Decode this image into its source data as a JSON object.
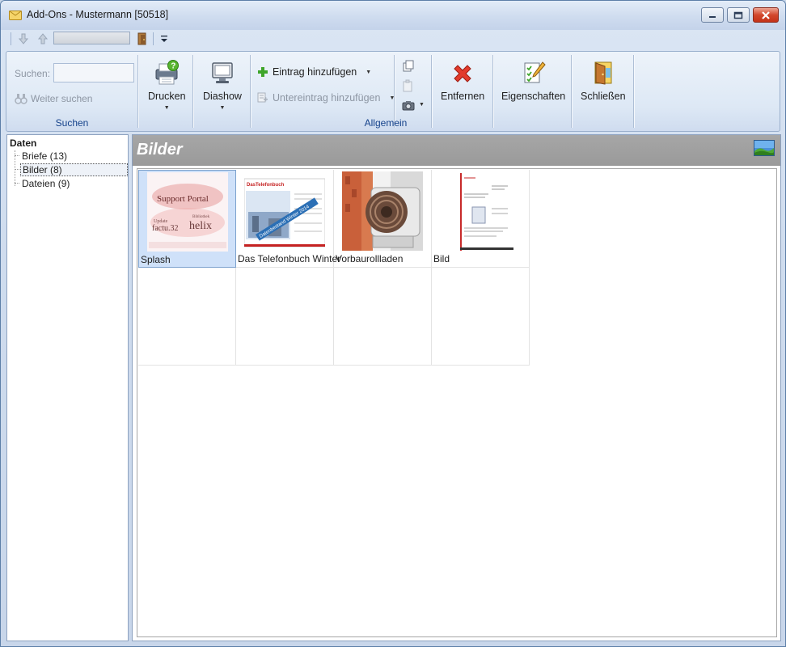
{
  "window": {
    "title": "Add-Ons - Mustermann [50518]"
  },
  "ribbon": {
    "search_group": {
      "label": "Suchen",
      "search_label": "Suchen:",
      "search_value": "",
      "next_search": "Weiter suchen"
    },
    "general_group": {
      "label": "Allgemein",
      "print": "Drucken",
      "slideshow": "Diashow",
      "add_entry": "Eintrag hinzufügen",
      "add_subentry": "Untereintrag hinzufügen",
      "remove": "Entfernen",
      "properties": "Eigenschaften",
      "close": "Schließen"
    }
  },
  "tree": {
    "root": "Daten",
    "items": [
      {
        "label": "Briefe (13)",
        "selected": false
      },
      {
        "label": "Bilder (8)",
        "selected": true
      },
      {
        "label": "Dateien (9)",
        "selected": false
      }
    ]
  },
  "content": {
    "title": "Bilder",
    "items": [
      {
        "caption": "Splash",
        "selected": true
      },
      {
        "caption": "Das Telefonbuch Winter",
        "selected": false
      },
      {
        "caption": "Vorbaurollladen",
        "selected": false
      },
      {
        "caption": "Bild",
        "selected": false
      }
    ],
    "thumb_text": {
      "splash_title": "Support Portal",
      "splash_line1": "factu.32",
      "splash_line2": "helix",
      "splash_line3": "Update",
      "splash_line4": "Bibliothek",
      "telefon_brand": "DasTelefonbuch",
      "telefon_ribbon": "Datenbestand Winter 2014"
    }
  },
  "colors": {
    "accent": "#15428b",
    "header_bg": "#9e9e9e",
    "selection": "#cfe1f9",
    "close_red": "#c43219"
  }
}
